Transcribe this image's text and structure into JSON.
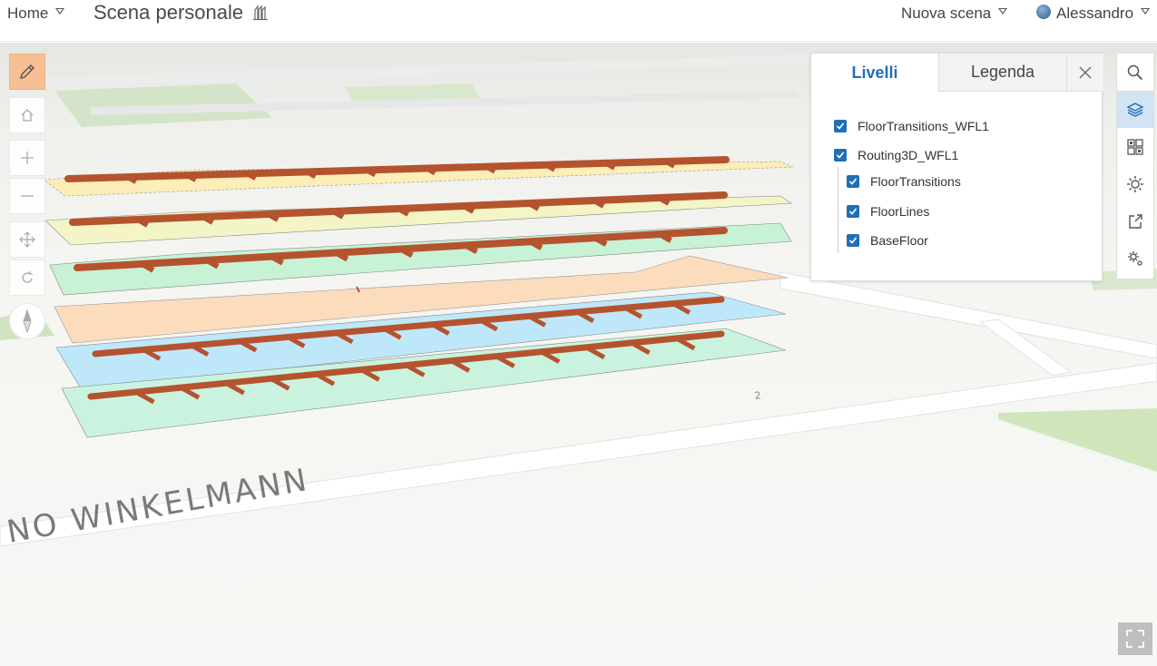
{
  "header": {
    "home_label": "Home",
    "title": "Scena personale",
    "new_scene_label": "Nuova scena",
    "user_name": "Alessandro"
  },
  "map": {
    "street_label": "NO WINKELMANN",
    "street_number": "2"
  },
  "left_toolbar": {
    "icons": [
      "pencil-icon",
      "home-icon",
      "plus-icon",
      "minus-icon",
      "pan-icon",
      "rotate-icon",
      "compass-icon"
    ],
    "active_color": "#f7bf93"
  },
  "layer_panel": {
    "tabs": [
      {
        "label": "Livelli",
        "active": true
      },
      {
        "label": "Legenda",
        "active": false
      }
    ],
    "layers": [
      {
        "label": "FloorTransitions_WFL1",
        "checked": true
      },
      {
        "label": "Routing3D_WFL1",
        "checked": true,
        "children": [
          {
            "label": "FloorTransitions",
            "checked": true
          },
          {
            "label": "FloorLines",
            "checked": true
          },
          {
            "label": "BaseFloor",
            "checked": true
          }
        ]
      }
    ],
    "accent_color": "#1f6fb7"
  },
  "right_rail": {
    "icons": [
      "search-icon",
      "layers-icon",
      "basemap-icon",
      "daylight-icon",
      "share-icon",
      "settings-icon"
    ],
    "active": "layers-icon"
  },
  "floor_colors": [
    "#fbeeb7",
    "#f3f5c6",
    "#c7f2d6",
    "#fbdcbd",
    "#bfe7fa",
    "#c9f3de"
  ],
  "route_color": "#b5532f"
}
